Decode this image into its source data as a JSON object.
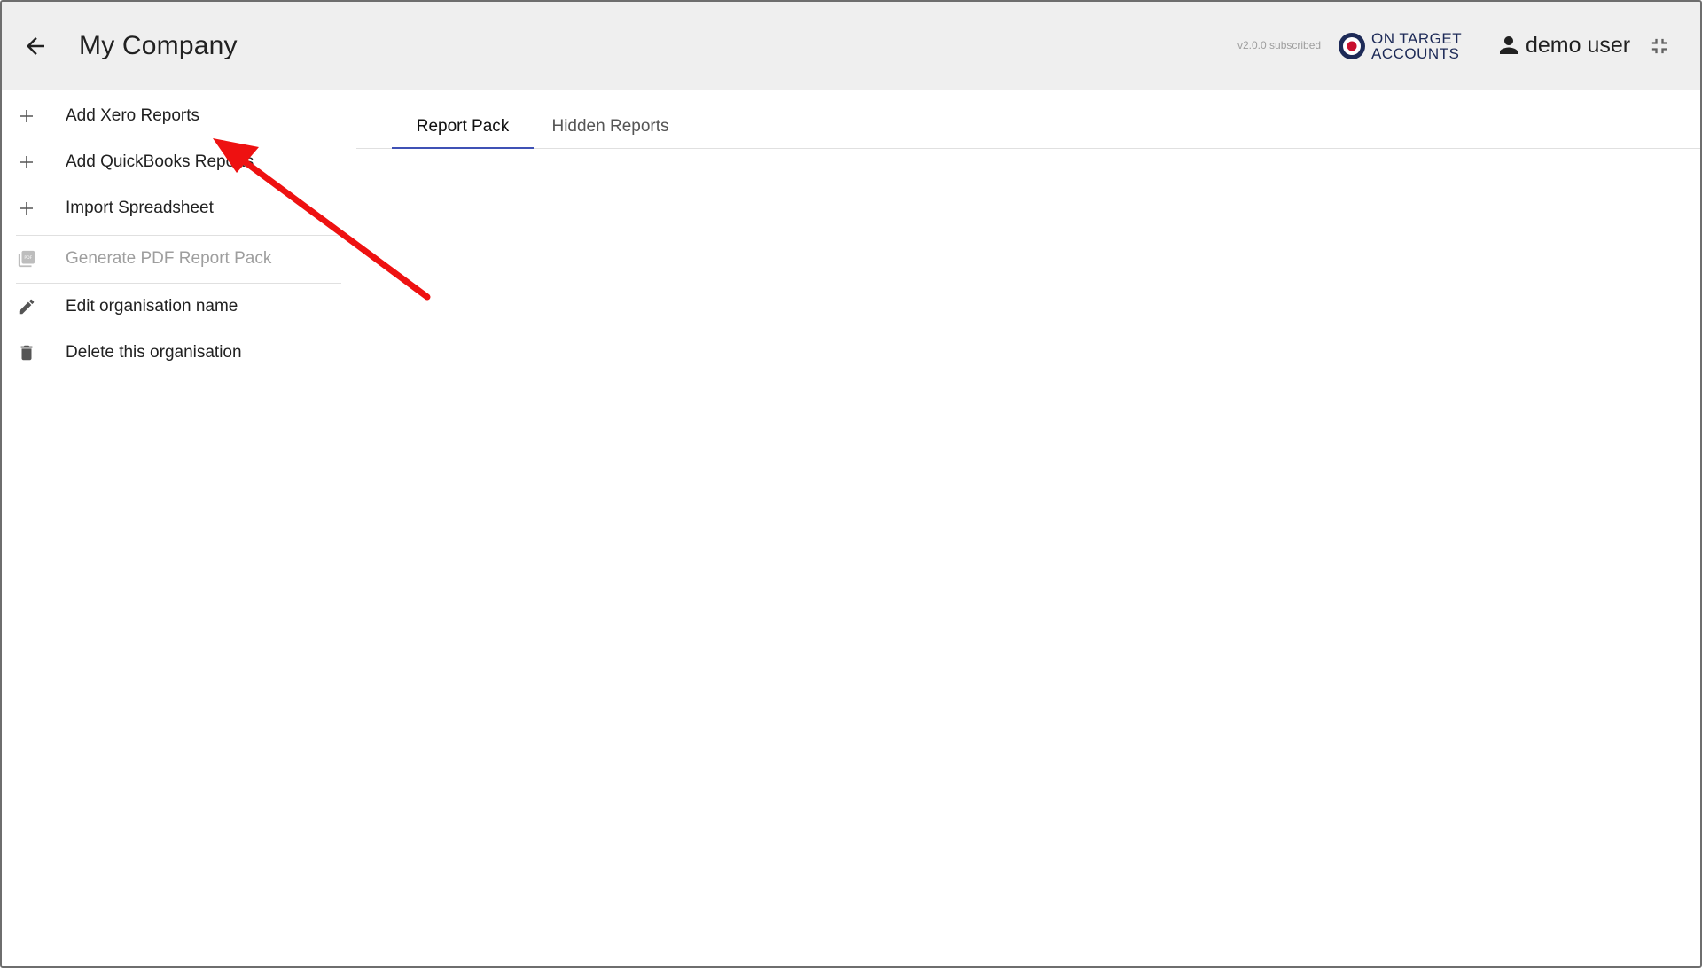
{
  "header": {
    "title": "My Company",
    "version": "v2.0.0 subscribed",
    "logo_line1": "ON TARGET",
    "logo_line2": "ACCOUNTS",
    "user_name": "demo user"
  },
  "sidebar": {
    "items": [
      {
        "label": "Add Xero Reports",
        "icon": "plus-icon"
      },
      {
        "label": "Add QuickBooks Reports",
        "icon": "plus-icon"
      },
      {
        "label": "Import Spreadsheet",
        "icon": "plus-icon"
      },
      {
        "label": "Generate PDF Report Pack",
        "icon": "pdf-icon",
        "disabled": true
      },
      {
        "label": "Edit organisation name",
        "icon": "pencil-icon"
      },
      {
        "label": "Delete this organisation",
        "icon": "trash-icon"
      }
    ]
  },
  "tabs": [
    {
      "label": "Report Pack",
      "active": true
    },
    {
      "label": "Hidden Reports",
      "active": false
    }
  ],
  "colors": {
    "header_bg": "#efefef",
    "tab_indicator": "#3f51b5",
    "annotation_arrow": "#ee1111",
    "logo_navy": "#1d2a57",
    "logo_red": "#c8102e"
  }
}
